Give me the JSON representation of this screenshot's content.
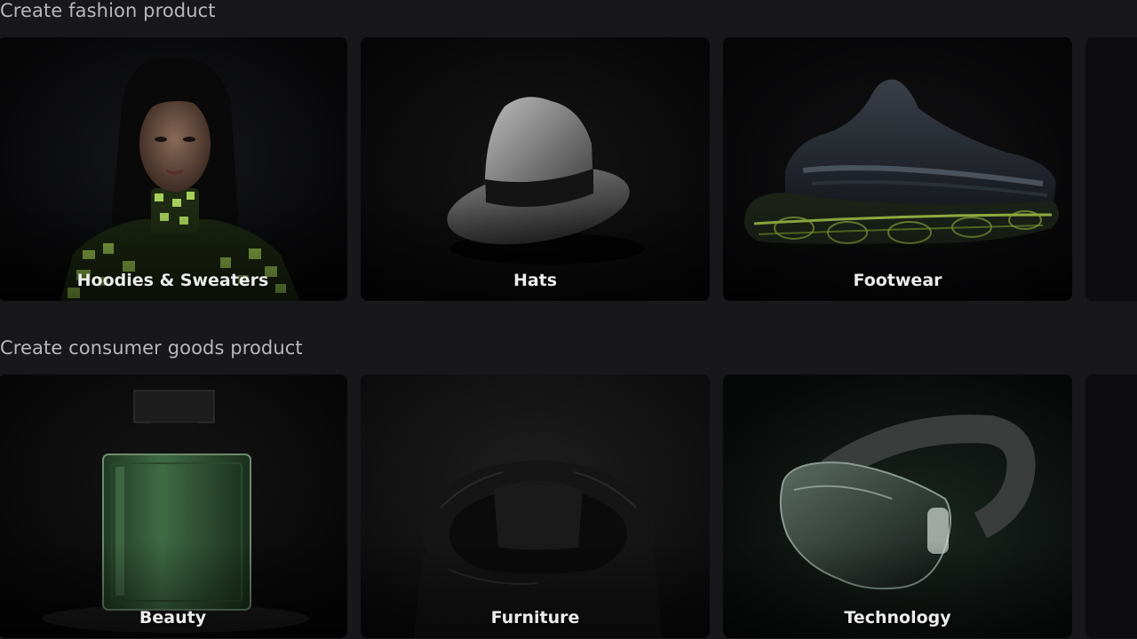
{
  "sections": [
    {
      "title": "Create fashion product",
      "cards": [
        {
          "label": "Hoodies & Sweaters",
          "image_icon": "woman-sweater-image"
        },
        {
          "label": "Hats",
          "image_icon": "fedora-hat-image"
        },
        {
          "label": "Footwear",
          "image_icon": "sneaker-image"
        },
        {
          "label": "",
          "image_icon": "partial-card-image"
        }
      ]
    },
    {
      "title": "Create consumer goods product",
      "cards": [
        {
          "label": "Beauty",
          "image_icon": "perfume-bottle-image"
        },
        {
          "label": "Furniture",
          "image_icon": "bean-bag-chair-image"
        },
        {
          "label": "Technology",
          "image_icon": "vr-goggles-image"
        },
        {
          "label": "",
          "image_icon": "partial-card-image"
        }
      ]
    }
  ],
  "colors": {
    "background": "#18181b",
    "card": "#0b0b0c",
    "accent_green": "#8fc24a",
    "title_text": "#b8b8bc",
    "label_text": "#ececec"
  }
}
